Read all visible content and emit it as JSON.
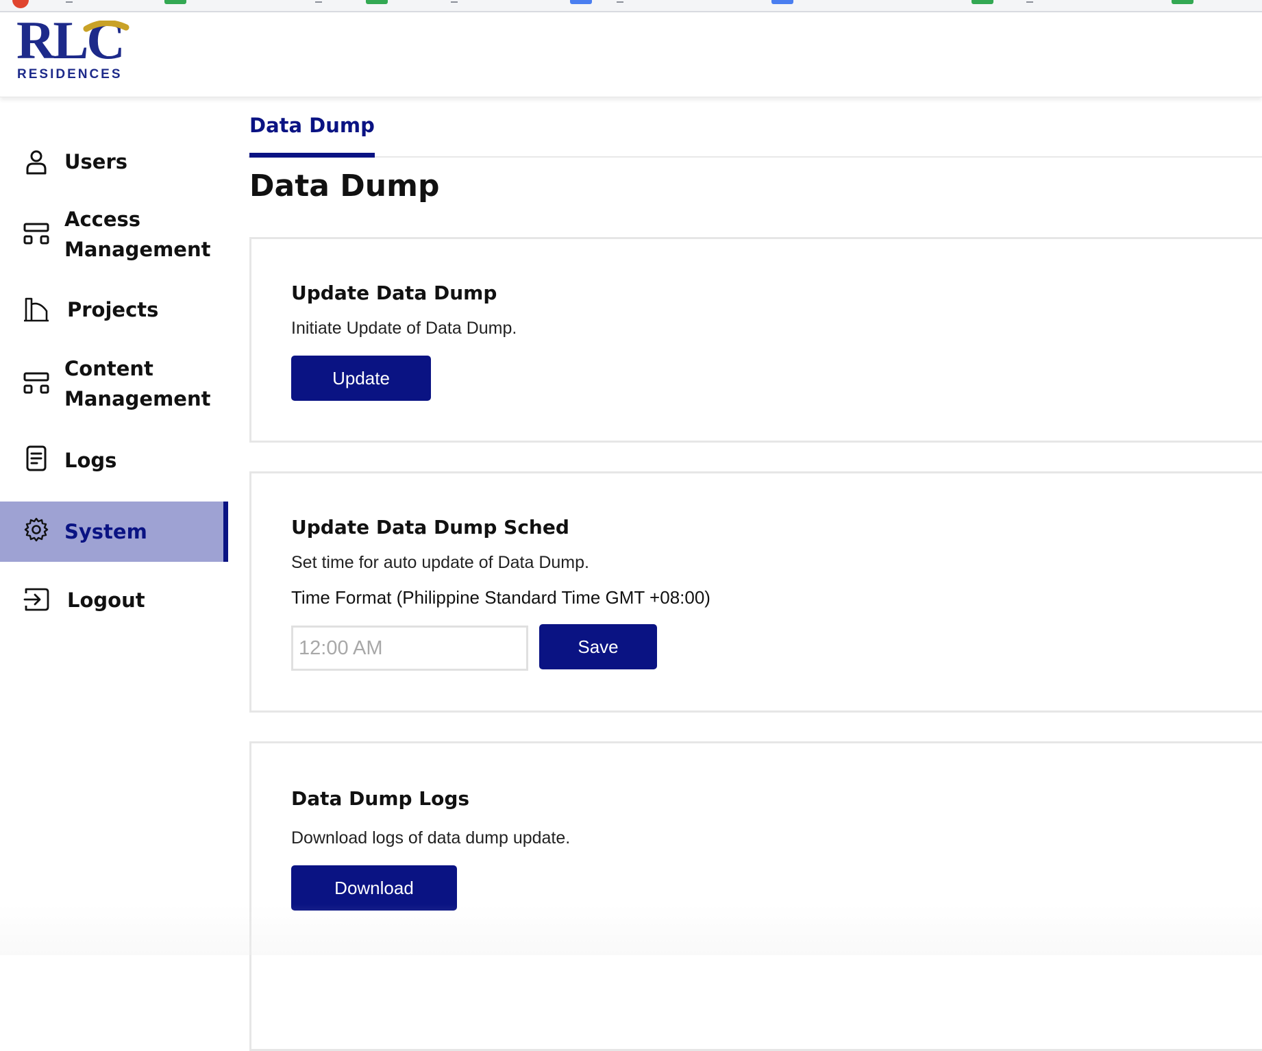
{
  "app": {
    "logo_text": "RLC",
    "logo_subtext": "RESIDENCES",
    "brand_color": "#1d2a8a",
    "accent_color": "#0a1383",
    "active_nav_bg": "#9ea2d3"
  },
  "sidebar": {
    "items": [
      {
        "label": "Users",
        "icon": "user-icon",
        "active": false
      },
      {
        "label": "Access\nManagement",
        "icon": "layout-icon",
        "active": false
      },
      {
        "label": "Projects",
        "icon": "building-icon",
        "active": false
      },
      {
        "label": "Content\nManagement",
        "icon": "layout-icon",
        "active": false
      },
      {
        "label": "Logs",
        "icon": "document-icon",
        "active": false
      },
      {
        "label": "System",
        "icon": "gear-icon",
        "active": true
      },
      {
        "label": "Logout",
        "icon": "logout-icon",
        "active": false
      }
    ]
  },
  "main": {
    "tabs": [
      {
        "label": "Data Dump",
        "active": true
      }
    ],
    "page_title": "Data Dump",
    "cards": {
      "update": {
        "title": "Update Data Dump",
        "description": "Initiate Update of Data Dump.",
        "button_label": "Update"
      },
      "schedule": {
        "title": "Update Data Dump Sched",
        "description": "Set time for auto update of Data Dump.",
        "time_format_label": "Time Format (Philippine Standard Time GMT +08:00)",
        "time_placeholder": "12:00 AM",
        "button_label": "Save"
      },
      "logs": {
        "title": "Data Dump Logs",
        "description": "Download logs of data dump update.",
        "button_label": "Download"
      }
    }
  }
}
